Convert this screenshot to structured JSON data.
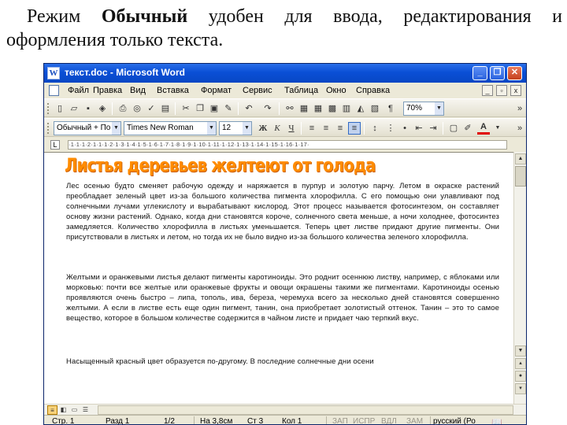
{
  "caption": {
    "prefix": "Режим ",
    "bold": "Обычный",
    "suffix": " удобен для ввода, редактирования и оформления только текста."
  },
  "window": {
    "title": "текст.doc - Microsoft Word",
    "minimize": "_",
    "restore": "❐",
    "close": "✕"
  },
  "menu": {
    "items": [
      "Файл",
      "Правка",
      "Вид",
      "Вставка",
      "Формат",
      "Сервис",
      "Таблица",
      "Окно",
      "Справка"
    ],
    "mini_min": "_",
    "mini_restore": "▫",
    "mini_close": "x"
  },
  "standard_toolbar": {
    "zoom": "70%",
    "pilcrow": "¶"
  },
  "format_toolbar": {
    "style": "Обычный + По ц",
    "font": "Times New Roman",
    "size": "12",
    "bold": "Ж",
    "italic": "К",
    "underline": "Ч",
    "font_color_letter": "A"
  },
  "ruler": {
    "scale": "·1·1·1·2·1·1·1·2·1·3·1·4·1·5·1·6·1·7·1·8·1·9·1·10·1·11·1·12·1·13·1·14·1·15·1·16·1·17·"
  },
  "document": {
    "heading": "Листья деревьев желтеют от голода",
    "para1": "Лес осенью будто сменяет рабочую одежду и наряжается в пурпур и золотую парчу. Летом в окраске растений преобладает зеленый цвет из-за большого количества пигмента хлорофилла. С его помощью они улавливают под солнечными лучами углекислоту и вырабатывают кислород. Этот процесс называется фотосинтезом, он составляет основу жизни растений. Однако, когда дни становятся короче, солнечного света меньше, а ночи холоднее, фотосинтез замедляется. Количество хлорофилла в листьях уменьшается. Теперь цвет листве придают другие пигменты. Они присутствовали в листьях и летом, но тогда их не было видно из-за большого количества зеленого хлорофилла.",
    "para2": "Желтыми и оранжевыми листья делают пигменты каротиноиды. Это роднит осеннюю листву, например, с яблоками или морковью: почти все желтые или оранжевые фрукты и овощи окрашены такими же пигментами. Каротиноиды осенью проявляются очень быстро – липа, тополь, ива, береза, черемуха всего за несколько дней становятся совершенно желтыми. А если в листве есть еще один пигмент, танин, она приобретает золотистый оттенок. Танин – это то самое вещество, которое в большом количестве содержится в чайном листе и придает чаю терпкий вкус.",
    "para3": "Насыщенный красный цвет образуется по-другому. В последние солнечные дни осени"
  },
  "status": {
    "page": "Стр. 1",
    "section": "Разд 1",
    "pages": "1/2",
    "position": "На 3,8см",
    "line": "Ст 3",
    "column": "Кол 1",
    "rec": "ЗАП",
    "trk": "ИСПР",
    "ext": "ВДЛ",
    "ovr": "ЗАМ",
    "language": "русский (Ро"
  }
}
